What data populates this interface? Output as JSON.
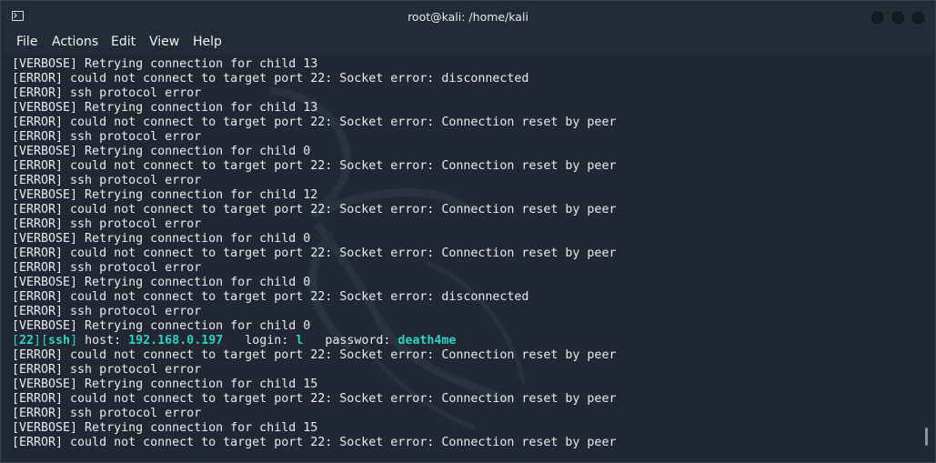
{
  "window": {
    "title": "root@kali: /home/kali"
  },
  "menu": {
    "file": "File",
    "actions": "Actions",
    "edit": "Edit",
    "view": "View",
    "help": "Help"
  },
  "terminal": {
    "lines": [
      "[VERBOSE] Retrying connection for child 13",
      "[ERROR] could not connect to target port 22: Socket error: disconnected",
      "[ERROR] ssh protocol error",
      "[VERBOSE] Retrying connection for child 13",
      "[ERROR] could not connect to target port 22: Socket error: Connection reset by peer",
      "[ERROR] ssh protocol error",
      "[VERBOSE] Retrying connection for child 0",
      "[ERROR] could not connect to target port 22: Socket error: Connection reset by peer",
      "[ERROR] ssh protocol error",
      "[VERBOSE] Retrying connection for child 12",
      "[ERROR] could not connect to target port 22: Socket error: Connection reset by peer",
      "[ERROR] ssh protocol error",
      "[VERBOSE] Retrying connection for child 0",
      "[ERROR] could not connect to target port 22: Socket error: Connection reset by peer",
      "[ERROR] ssh protocol error",
      "[VERBOSE] Retrying connection for child 0",
      "[ERROR] could not connect to target port 22: Socket error: disconnected",
      "[ERROR] ssh protocol error",
      "[VERBOSE] Retrying connection for child 0"
    ],
    "found": {
      "open_bracket": "[",
      "port": "22",
      "mid_bracket": "][",
      "service": "ssh",
      "close_bracket": "]",
      "host_label": " host: ",
      "host": "192.168.0.197",
      "login_label": "   login: ",
      "login": "l",
      "password_label": "   password: ",
      "password": "death4me"
    },
    "lines_after": [
      "[ERROR] could not connect to target port 22: Socket error: Connection reset by peer",
      "[ERROR] ssh protocol error",
      "[VERBOSE] Retrying connection for child 15",
      "[ERROR] could not connect to target port 22: Socket error: Connection reset by peer",
      "[ERROR] ssh protocol error",
      "[VERBOSE] Retrying connection for child 15",
      "[ERROR] could not connect to target port 22: Socket error: Connection reset by peer"
    ]
  },
  "colors": {
    "background": "#212833",
    "text": "#e8ebf0",
    "highlight": "#2fd2c4"
  }
}
